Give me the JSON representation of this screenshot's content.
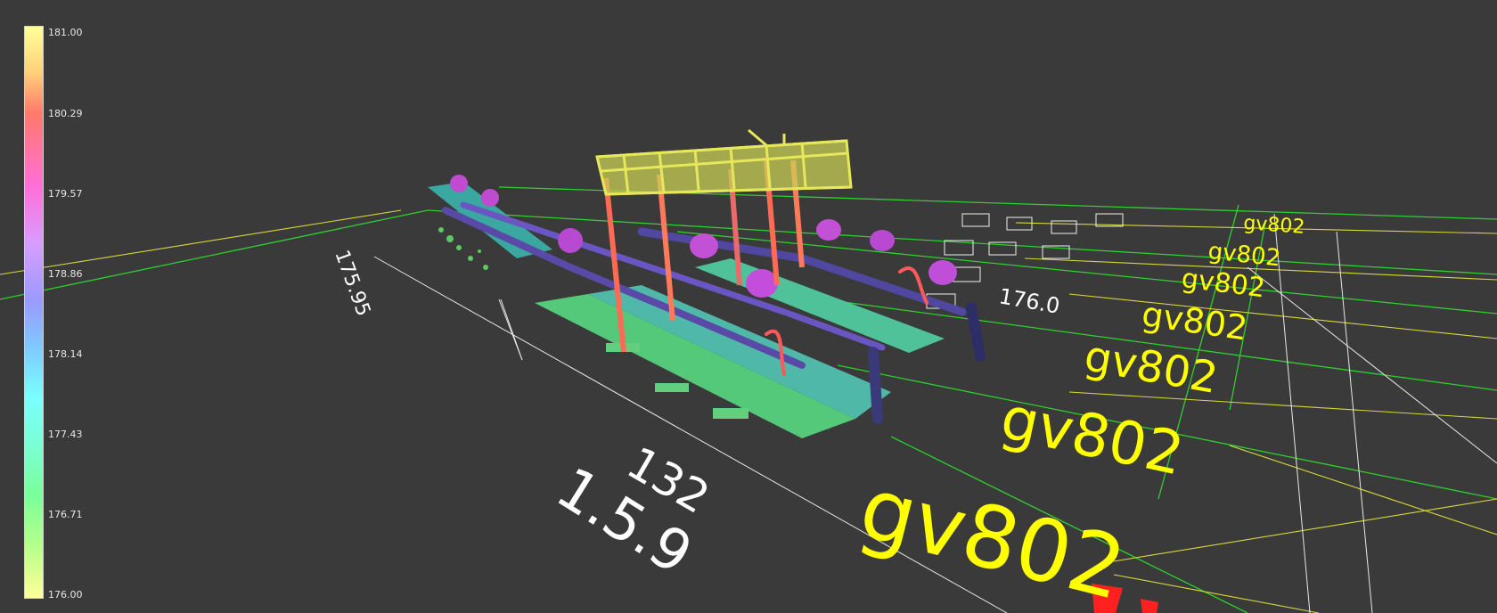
{
  "colorbar": {
    "labels": [
      "181.00",
      "180.29",
      "179.57",
      "178.86",
      "178.14",
      "177.43",
      "176.71",
      "176.00"
    ],
    "min": 176.0,
    "max": 181.0
  },
  "scene": {
    "cad_labels": [
      "gv802",
      "gv802",
      "gv802",
      "gv802",
      "gv802",
      "gv802",
      "gv802",
      "176.0",
      "175.95",
      "1.5.9",
      "132"
    ]
  },
  "colors": {
    "background": "#3a3a3a",
    "grid_green": "#2fcf2f",
    "grid_yellow": "#d8d83a",
    "cad_yellow": "#ffff00",
    "cad_white": "#ffffff",
    "marker_red": "#ff2020"
  }
}
